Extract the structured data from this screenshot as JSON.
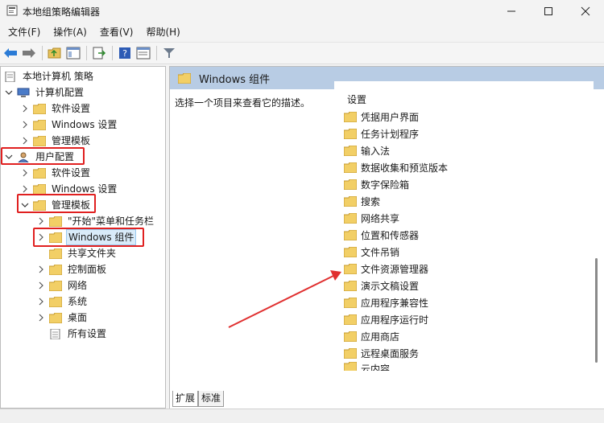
{
  "window": {
    "title": "本地组策略编辑器"
  },
  "menu": [
    "文件(F)",
    "操作(A)",
    "查看(V)",
    "帮助(H)"
  ],
  "tree": {
    "root": "本地计算机 策略",
    "computer": "计算机配置",
    "computer_children": [
      "软件设置",
      "Windows 设置",
      "管理模板"
    ],
    "user": "用户配置",
    "user_children": [
      "软件设置",
      "Windows 设置"
    ],
    "admin_templates": "管理模板",
    "admin_children": [
      "\"开始\"菜单和任务栏",
      "Windows 组件",
      "共享文件夹",
      "控制面板",
      "网络",
      "系统",
      "桌面",
      "所有设置"
    ]
  },
  "right": {
    "header_title": "Windows 组件",
    "description": "选择一个项目来查看它的描述。",
    "column_header": "设置",
    "items": [
      "凭据用户界面",
      "任务计划程序",
      "输入法",
      "数据收集和预览版本",
      "数字保险箱",
      "搜索",
      "网络共享",
      "位置和传感器",
      "文件吊销",
      "文件资源管理器",
      "演示文稿设置",
      "应用程序兼容性",
      "应用程序运行时",
      "应用商店",
      "远程桌面服务",
      "云内容"
    ]
  },
  "tabs": [
    "扩展",
    "标准"
  ],
  "colors": {
    "highlight": "#e02020",
    "header_bg": "#b8cce4",
    "selection": "#d9ebf9"
  }
}
